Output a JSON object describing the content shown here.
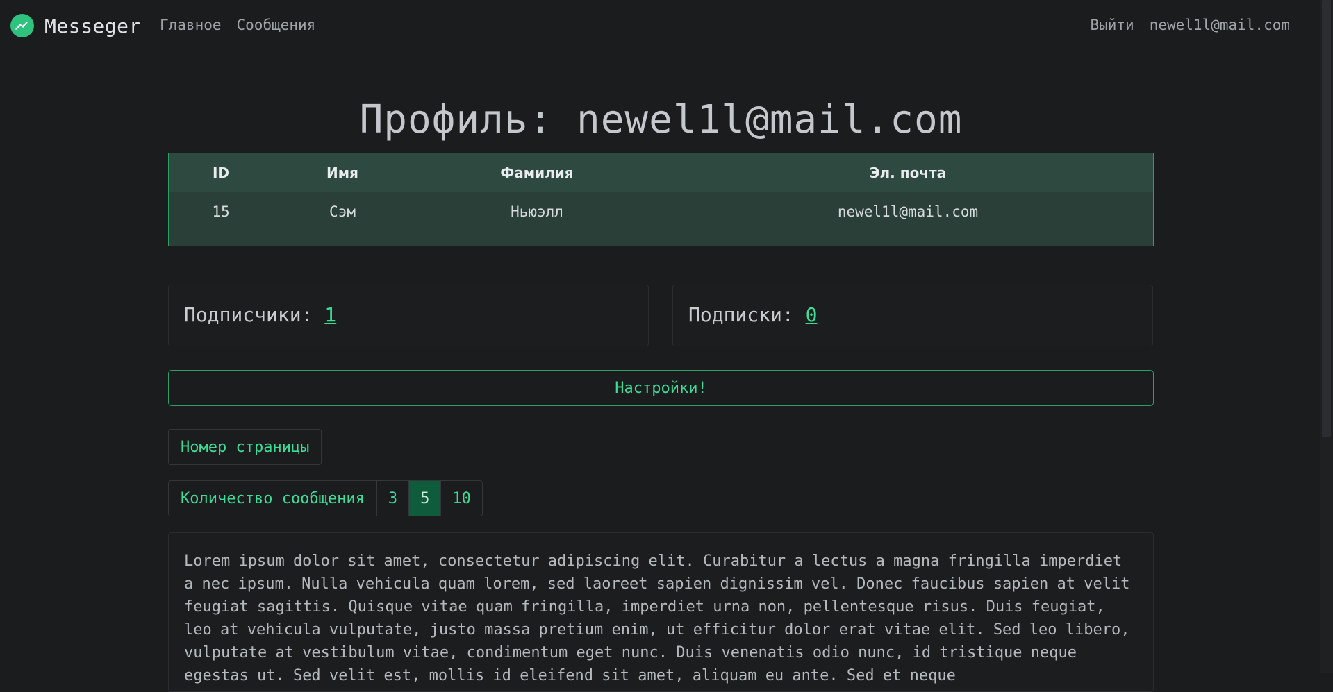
{
  "navbar": {
    "brand": "Messeger",
    "links": [
      "Главное",
      "Сообщения"
    ],
    "logout": "Выйти",
    "user_email": "newel1l@mail.com"
  },
  "page_title": "Профиль: newel1l@mail.com",
  "profile_table": {
    "headers": [
      "ID",
      "Имя",
      "Фамилия",
      "Эл. почта"
    ],
    "row": [
      "15",
      "Сэм",
      "Ньюэлл",
      "newel1l@mail.com"
    ]
  },
  "stats": {
    "followers_label": "Подписчики: ",
    "followers_count": "1",
    "following_label": "Подписки: ",
    "following_count": "0"
  },
  "settings_button": "Настройки!",
  "page_number_button": "Номер страницы",
  "message_count": {
    "label": "Количество сообщения",
    "options": [
      "3",
      "5",
      "10"
    ],
    "selected": "5"
  },
  "post": {
    "text": "Lorem ipsum dolor sit amet, consectetur adipiscing elit. Curabitur a lectus a magna fringilla imperdiet a nec ipsum. Nulla vehicula quam lorem, sed laoreet sapien dignissim vel. Donec faucibus sapien at velit feugiat sagittis. Quisque vitae quam fringilla, imperdiet urna non, pellentesque risus. Duis feugiat, leo at vehicula vulputate, justo massa pretium enim, ut efficitur dolor erat vitae elit. Sed leo libero, vulputate at vestibulum vitae, condimentum eget nunc. Duis venenatis odio nunc, id tristique neque egestas ut. Sed velit est, mollis id eleifend sit amet, aliquam eu ante. Sed et neque"
  },
  "colors": {
    "background": "#1b1c1e",
    "accent": "#3ddc97",
    "table_bg": "#2a3f38",
    "active_option": "#0f5c3c"
  }
}
